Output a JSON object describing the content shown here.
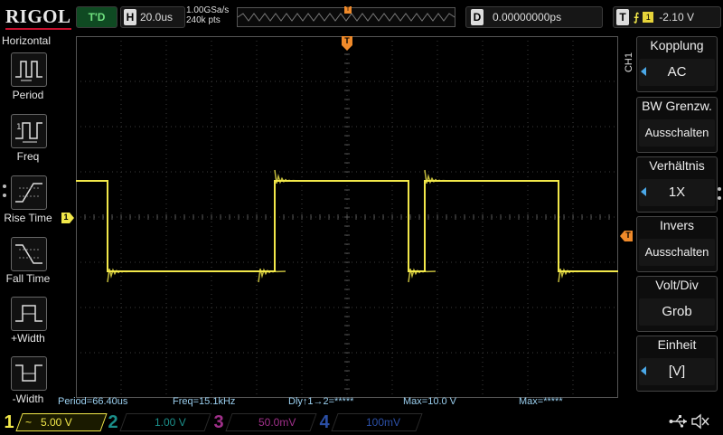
{
  "brand": "RIGOL",
  "header": {
    "trigger_status": "T'D",
    "timebase_key": "H",
    "timebase_value": "20.0us",
    "sample_rate": "1.00GSa/s",
    "memory_depth": "240k pts",
    "trigger_position_marker": "T",
    "delay_key": "D",
    "delay_value": "0.00000000ps",
    "trigger_key": "T",
    "trigger_source": "1",
    "trigger_level": "-2.10 V"
  },
  "left_menu": {
    "title": "Horizontal",
    "items": [
      {
        "label": "Period",
        "icon": "period-icon"
      },
      {
        "label": "Freq",
        "icon": "frequency-icon"
      },
      {
        "label": "Rise Time",
        "icon": "rise-time-icon"
      },
      {
        "label": "Fall Time",
        "icon": "fall-time-icon"
      },
      {
        "label": "+Width",
        "icon": "positive-width-icon"
      },
      {
        "label": "-Width",
        "icon": "negative-width-icon"
      }
    ]
  },
  "right_menu": {
    "channel_label": "CH1",
    "items": [
      {
        "title": "Kopplung",
        "value": "AC",
        "arrow": true
      },
      {
        "title": "BW Grenzw.",
        "value": "Ausschalten",
        "arrow": false
      },
      {
        "title": "Verhältnis",
        "value": "1X",
        "arrow": true
      },
      {
        "title": "Invers",
        "value": "Ausschalten",
        "arrow": false
      },
      {
        "title": "Volt/Div",
        "value": "Grob",
        "arrow": false
      },
      {
        "title": "Einheit",
        "value": "[V]",
        "arrow": true
      }
    ]
  },
  "markers": {
    "channel1": "1",
    "trigger_top": "T",
    "trigger_level_arrow": "T"
  },
  "measurements": {
    "period": "Period=66.40us",
    "freq": "Freq=15.1kHz",
    "delay": "Dly↑1→2=*****",
    "max1": "Max=10.0 V",
    "max2": "Max=*****"
  },
  "channels": [
    {
      "number": "1",
      "coupling_symbol": "~",
      "scale": "5.00 V",
      "color": "#f2e84a"
    },
    {
      "number": "2",
      "coupling_symbol": "",
      "scale": "1.00 V",
      "color": "#1b8f8a"
    },
    {
      "number": "3",
      "coupling_symbol": "",
      "scale": "50.0mV",
      "color": "#a0308a"
    },
    {
      "number": "4",
      "coupling_symbol": "",
      "scale": "100mV",
      "color": "#2b4fa6"
    }
  ],
  "status_icons": [
    "usb-icon",
    "speaker-muted-icon"
  ],
  "colors": {
    "trace": "#f2e84a",
    "grid": "#3c3c3c",
    "trigger_marker": "#f08a2a",
    "menu_arrow": "#4aa8e8",
    "measurement_text": "#9bd0f0"
  },
  "waveform": {
    "type": "square",
    "period_us": 66.4,
    "timebase_us_per_div": 20.0,
    "volts_per_div": 5.0,
    "high_v": 5.0,
    "low_v": -5.0,
    "rising_edges_div": [
      4.4,
      7.72
    ],
    "falling_edges_div": [
      0.7,
      4.04,
      7.36,
      10.68
    ]
  }
}
